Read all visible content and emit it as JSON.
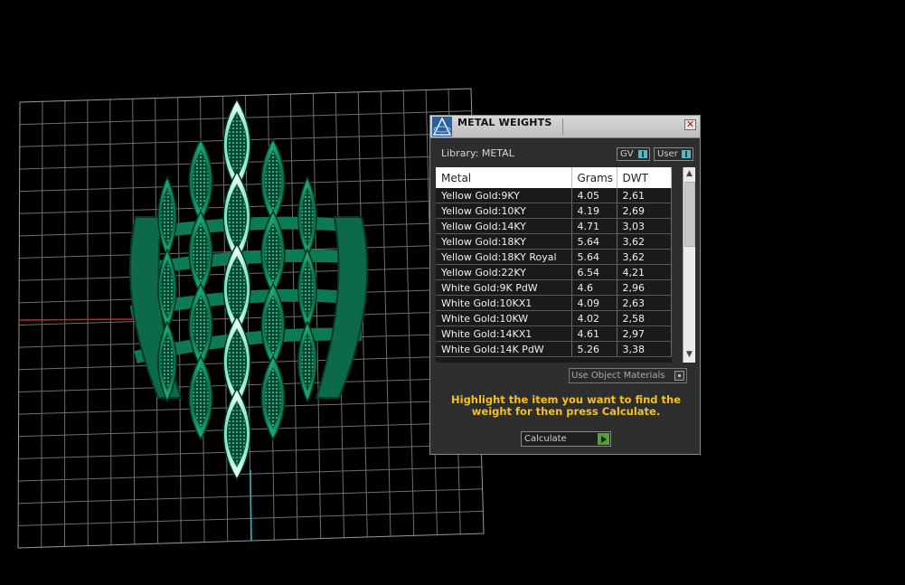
{
  "panel": {
    "title": "METAL WEIGHTS",
    "close_icon": "✕",
    "library_label": "Library: METAL",
    "gv_label": "GV",
    "user_label": "User",
    "columns": [
      "Metal",
      "Grams",
      "DWT"
    ],
    "rows": [
      {
        "metal": "Yellow Gold:9KY",
        "grams": "4.05",
        "dwt": "2,61"
      },
      {
        "metal": "Yellow Gold:10KY",
        "grams": "4.19",
        "dwt": "2,69"
      },
      {
        "metal": "Yellow Gold:14KY",
        "grams": "4.71",
        "dwt": "3,03"
      },
      {
        "metal": "Yellow Gold:18KY",
        "grams": "5.64",
        "dwt": "3,62"
      },
      {
        "metal": "Yellow Gold:18KY Royal",
        "grams": "5.64",
        "dwt": "3,62"
      },
      {
        "metal": "Yellow Gold:22KY",
        "grams": "6.54",
        "dwt": "4,21"
      },
      {
        "metal": "White Gold:9K PdW",
        "grams": "4.6",
        "dwt": "2,96"
      },
      {
        "metal": "White Gold:10KX1",
        "grams": "4.09",
        "dwt": "2,63"
      },
      {
        "metal": "White Gold:10KW",
        "grams": "4.02",
        "dwt": "2,58"
      },
      {
        "metal": "White Gold:14KX1",
        "grams": "4.61",
        "dwt": "2,97"
      },
      {
        "metal": "White Gold:14K PdW",
        "grams": "5.26",
        "dwt": "3,38"
      }
    ],
    "use_object_materials_label": "Use Object Materials",
    "instructions": "Highlight the item you want to find the weight for then press Calculate.",
    "calculate_label": "Calculate"
  },
  "colors": {
    "model_green": "#0f8f63",
    "highlight": "#bff5e2",
    "instruction_yellow": "#f4c21a",
    "x_axis": "#cc2222",
    "z_axis": "#1fb8c9"
  },
  "icons": {
    "logo": "matrix-logo-icon",
    "close": "close-icon",
    "scroll_up": "chevron-up-icon",
    "scroll_down": "chevron-down-icon",
    "calculate": "play-arrow-icon"
  }
}
